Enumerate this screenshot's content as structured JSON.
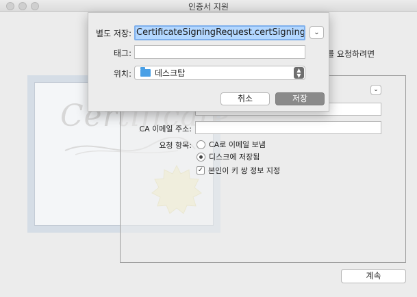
{
  "window": {
    "title": "인증서 지원"
  },
  "certificate_art": {
    "word": "Certificate"
  },
  "form": {
    "intro_text": "증서를 요청하려면",
    "user_email_label": "",
    "common_name_value": "",
    "ca_email_label": "CA 이메일 주소:",
    "request_label": "요청 항목:",
    "options": [
      {
        "label": "CA로 이메일 보냄",
        "selected": false
      },
      {
        "label": "디스크에 저장됨",
        "selected": true
      }
    ],
    "key_pair_label": "본인이 키 쌍 정보 지정",
    "key_pair_checked": true,
    "continue_label": "계속"
  },
  "save_sheet": {
    "saveas_label": "별도 저장:",
    "saveas_value": "CertificateSigningRequest.certSigningRe",
    "tags_label": "태그:",
    "where_label": "위치:",
    "where_value": "데스크탑",
    "cancel_label": "취소",
    "save_label": "저장"
  },
  "colors": {
    "selection": "#b3d7ff",
    "focus_ring": "#7fb0ec",
    "folder": "#4aa0e6",
    "default_button": "#8a8a8a"
  }
}
